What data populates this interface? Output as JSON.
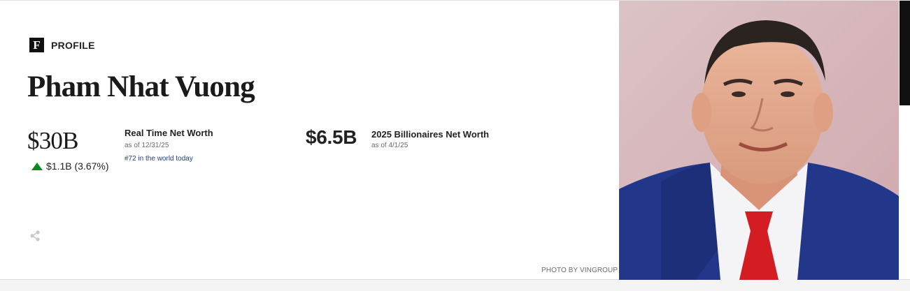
{
  "profile": {
    "logo_letter": "F",
    "label": "PROFILE"
  },
  "person": {
    "name": "Pham Nhat Vuong"
  },
  "real_time": {
    "value": "$30B",
    "change": "$1.1B (3.67%)",
    "change_direction": "up",
    "change_color": "#0c8a23",
    "label": "Real Time Net Worth",
    "as_of": "as of 12/31/25",
    "rank_text": "#72 in the world today"
  },
  "billionaires": {
    "value": "$6.5B",
    "label": "2025 Billionaires Net Worth",
    "as_of": "as of 4/1/25"
  },
  "photo": {
    "credit": "PHOTO BY VINGROUP"
  },
  "icons": {
    "share": "share-icon"
  }
}
